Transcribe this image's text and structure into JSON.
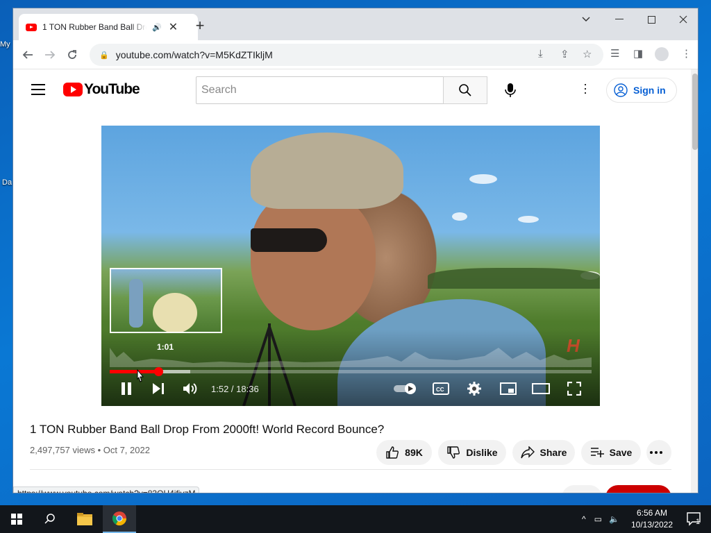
{
  "desktop": {
    "icon_labels": [
      "My",
      "Da"
    ]
  },
  "browser": {
    "tab_title": "1 TON Rubber Band Ball Drop From 2000ft! World Record Bounce? - YouTube",
    "url": "youtube.com/watch?v=M5KdZTIkljM",
    "status_url": "https://www.youtube.com/watch?v=83QH4ifjvzM"
  },
  "youtube": {
    "logo_text": "YouTube",
    "search_placeholder": "Search",
    "sign_in": "Sign in"
  },
  "player": {
    "preview_time": "1:01",
    "time_display": "1:52 / 18:36",
    "progress_played": 0.101,
    "progress_loaded": 0.167,
    "preview_progress": 0.055
  },
  "video": {
    "title": "1 TON Rubber Band Ball Drop From 2000ft! World Record Bounce?",
    "views": "2,497,757 views",
    "date": "Oct 7, 2022",
    "likes": "89K",
    "dislike_label": "Dislike",
    "share_label": "Share",
    "save_label": "Save",
    "subscribe_label": "Subscribe"
  },
  "taskbar": {
    "time": "6:56 AM",
    "date": "10/13/2022",
    "notifications": "1"
  },
  "colors": {
    "youtube_red": "#ff0000",
    "link_blue": "#065fd4",
    "subscribe_red": "#cc0000"
  }
}
